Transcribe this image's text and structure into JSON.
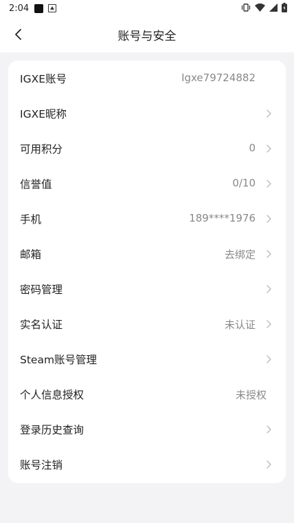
{
  "status_bar": {
    "time": "2:04"
  },
  "header": {
    "title": "账号与安全"
  },
  "rows": [
    {
      "label": "IGXE账号",
      "value": "Igxe79724882",
      "chevron": false
    },
    {
      "label": "IGXE昵称",
      "value": "",
      "chevron": true
    },
    {
      "label": "可用积分",
      "value": "0",
      "chevron": true
    },
    {
      "label": "信誉值",
      "value": "0/10",
      "chevron": true
    },
    {
      "label": "手机",
      "value": "189****1976",
      "chevron": true
    },
    {
      "label": "邮箱",
      "value": "去绑定",
      "chevron": true
    },
    {
      "label": "密码管理",
      "value": "",
      "chevron": true
    },
    {
      "label": "实名认证",
      "value": "未认证",
      "chevron": true
    },
    {
      "label": "Steam账号管理",
      "value": "",
      "chevron": true
    },
    {
      "label": "个人信息授权",
      "value": "未授权",
      "chevron": false
    },
    {
      "label": "登录历史查询",
      "value": "",
      "chevron": true
    },
    {
      "label": "账号注销",
      "value": "",
      "chevron": true
    }
  ],
  "colors": {
    "background": "#f3f3f5",
    "card": "#ffffff",
    "text_primary": "#222222",
    "text_secondary": "#888888",
    "chevron": "#bbbbbb"
  },
  "icons": {
    "back": "chevron-left-icon",
    "row_arrow": "chevron-right-icon",
    "vibrate": "vibrate-icon",
    "wifi": "wifi-icon",
    "signal": "signal-icon",
    "battery": "battery-icon"
  }
}
